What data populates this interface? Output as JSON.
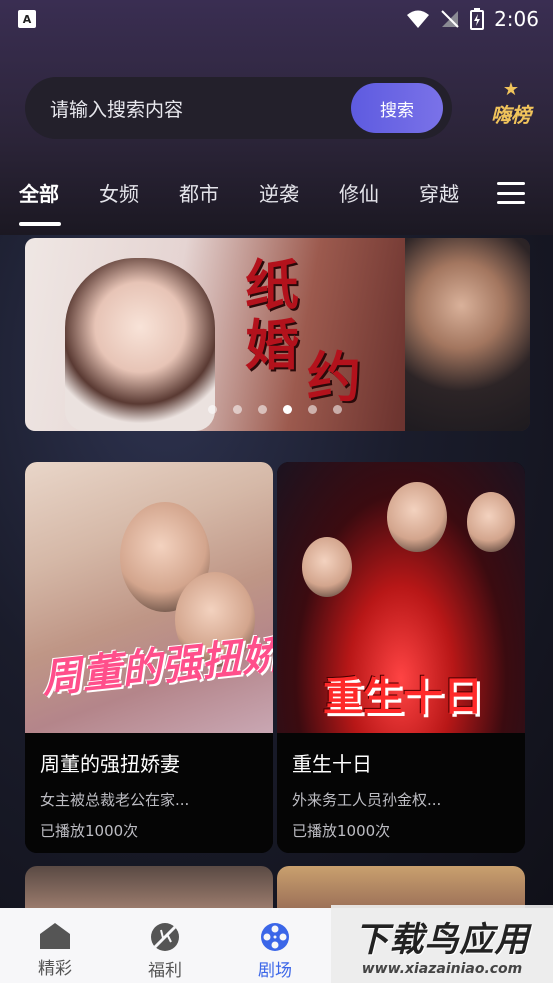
{
  "status_bar": {
    "time": "2:06",
    "left_icon_text": "A"
  },
  "search": {
    "placeholder": "请输入搜索内容",
    "button_label": "搜索",
    "ranking_label": "嗨榜"
  },
  "tabs": {
    "items": [
      "全部",
      "女频",
      "都市",
      "逆袭",
      "修仙",
      "穿越"
    ],
    "active_index": 0
  },
  "banner": {
    "title_chars": [
      "纸",
      "婚",
      "约"
    ],
    "dots_count": 6,
    "active_dot": 3
  },
  "cards": [
    {
      "title": "周董的强扭娇妻",
      "description": "女主被总裁老公在家...",
      "plays": "已播放1000次",
      "poster_text": "周董的强扭娇妻"
    },
    {
      "title": "重生十日",
      "description": "外来务工人员孙金权...",
      "plays": "已播放1000次",
      "poster_text": "重生十日"
    }
  ],
  "bottom_nav": {
    "items": [
      {
        "label": "精彩",
        "icon": "home-icon"
      },
      {
        "label": "福利",
        "icon": "leaf-icon"
      },
      {
        "label": "剧场",
        "icon": "film-reel-icon"
      }
    ],
    "active_index": 2
  },
  "watermark": {
    "title": "下载鸟应用",
    "url": "www.xiazainiao.com"
  }
}
